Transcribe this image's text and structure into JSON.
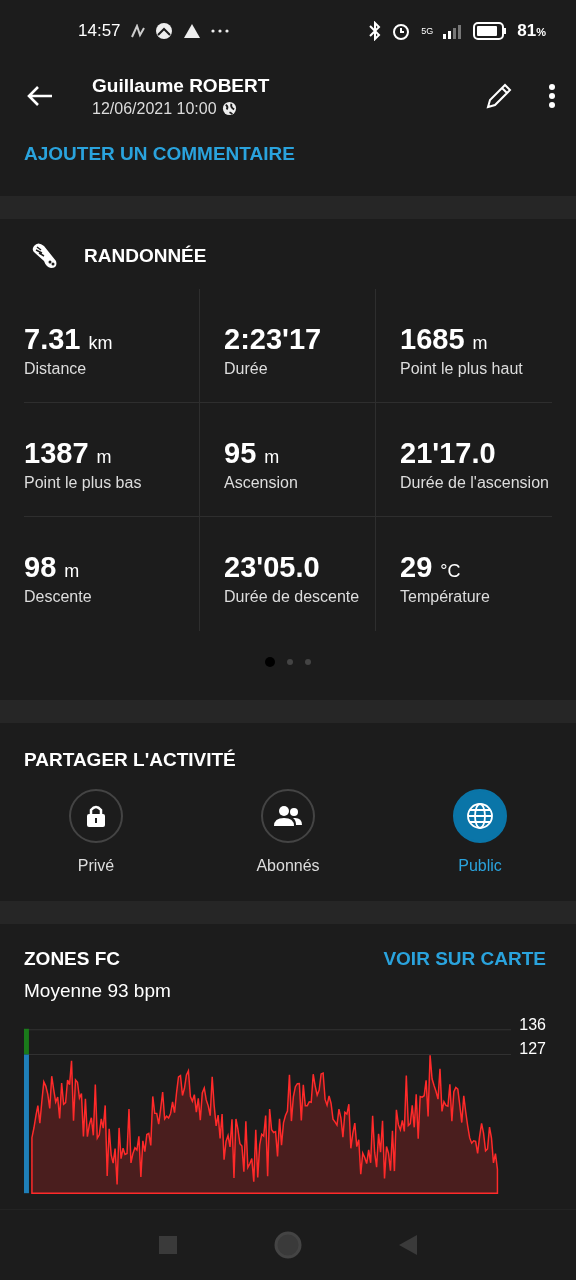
{
  "status_bar": {
    "time": "14:57",
    "network": "5G",
    "battery": "81",
    "battery_unit": "%"
  },
  "header": {
    "title": "Guillaume ROBERT",
    "subtitle": "12/06/2021 10:00"
  },
  "comment_link": "AJOUTER UN COMMENTAIRE",
  "activity": {
    "title": "RANDONNÉE",
    "stats": [
      {
        "value": "7.31",
        "unit": "km",
        "label": "Distance"
      },
      {
        "value": "2:23'17",
        "label": "Durée"
      },
      {
        "value": "1685",
        "unit": "m",
        "label": "Point le plus haut"
      },
      {
        "value": "1387",
        "unit": "m",
        "label": "Point le plus bas"
      },
      {
        "value": "95",
        "unit": "m",
        "label": "Ascension"
      },
      {
        "value": "21'17.0",
        "label": "Durée de l'ascension"
      },
      {
        "value": "98",
        "unit": "m",
        "label": "Descente"
      },
      {
        "value": "23'05.0",
        "label": "Durée de descente"
      },
      {
        "value": "29",
        "unit": "°C",
        "label": "Température"
      }
    ],
    "pages": [
      {
        "selected": true
      },
      {
        "selected": false
      },
      {
        "selected": false
      }
    ]
  },
  "share": {
    "title": "PARTAGER L'ACTIVITÉ",
    "options": [
      {
        "kind": "lock",
        "label": "Privé",
        "selected": false
      },
      {
        "kind": "people",
        "label": "Abonnés",
        "selected": false
      },
      {
        "kind": "globe",
        "label": "Public",
        "selected": true
      }
    ]
  },
  "zones": {
    "title": "ZONES FC",
    "link": "VOIR SUR CARTE",
    "average": "Moyenne 93 bpm",
    "tick_labels": [
      "136",
      "127"
    ]
  }
}
